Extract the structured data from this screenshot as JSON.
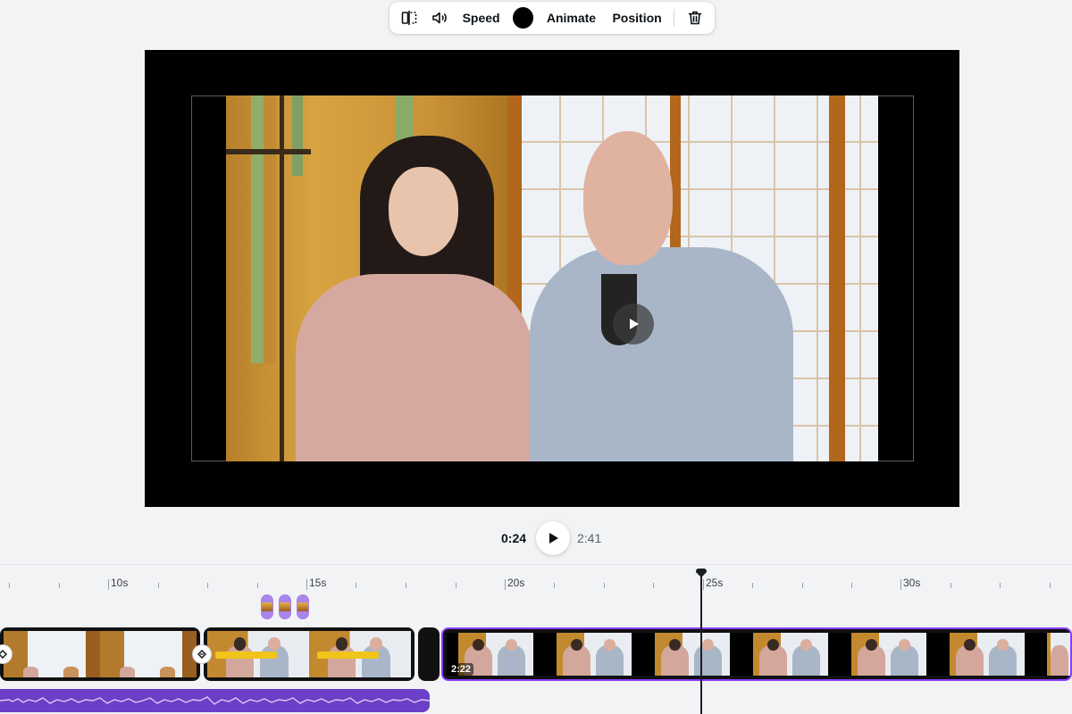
{
  "toolbar": {
    "speed_label": "Speed",
    "color_swatch": "#000000",
    "animate_label": "Animate",
    "position_label": "Position",
    "icons": [
      "flip-icon",
      "volume-icon",
      "trash-icon"
    ]
  },
  "playback": {
    "current_time": "0:24",
    "total_time": "2:41"
  },
  "timeline": {
    "ruler_labels": [
      "10s",
      "15s",
      "20s",
      "25s",
      "30s"
    ],
    "clips": [
      {
        "name": "clip-1"
      },
      {
        "name": "clip-2"
      },
      {
        "name": "clip-3"
      },
      {
        "name": "clip-4",
        "duration": "2:22",
        "selected": true
      }
    ],
    "markers_count": 3
  },
  "colors": {
    "accent": "#8b3dff",
    "audio_track": "#6b3fc7",
    "marker": "#a984ea"
  }
}
